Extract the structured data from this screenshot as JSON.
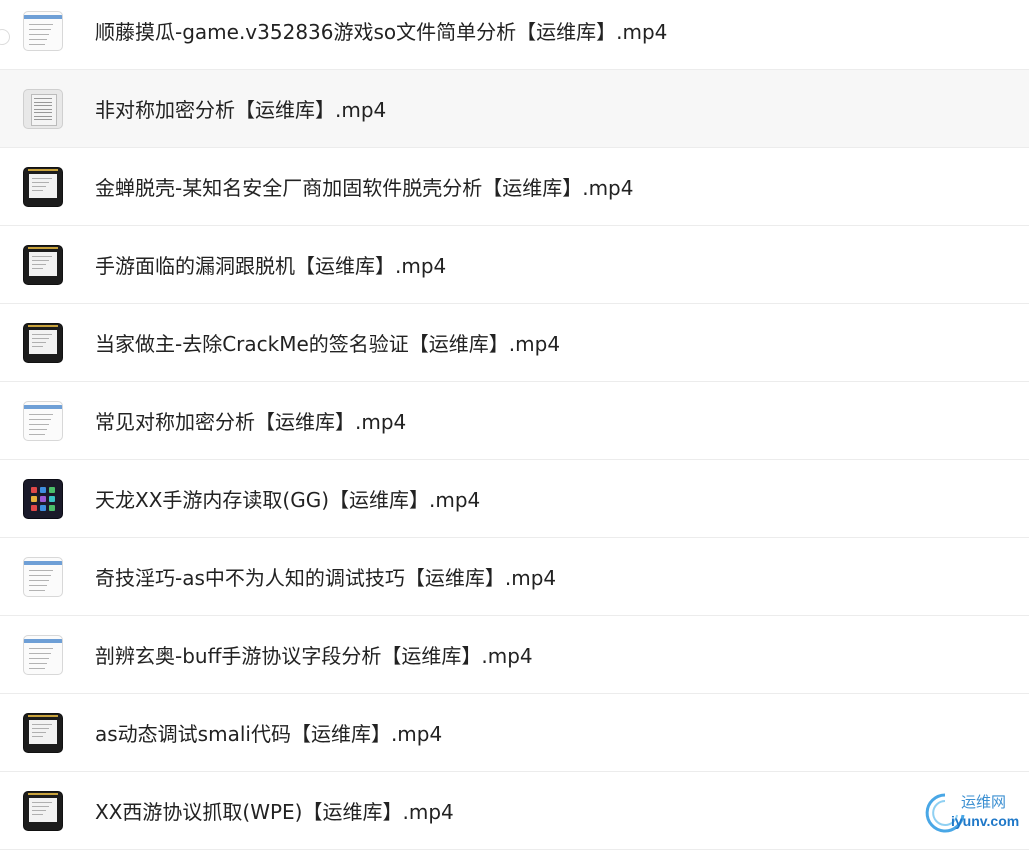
{
  "files": [
    {
      "name": "顺藤摸瓜-game.v352836游戏so文件简单分析【运维库】.mp4",
      "thumb": "light",
      "thumb_icon": "screenshot-thumbnail-icon"
    },
    {
      "name": "非对称加密分析【运维库】.mp4",
      "thumb": "doc",
      "thumb_icon": "document-thumbnail-icon"
    },
    {
      "name": "金蝉脱壳-某知名安全厂商加固软件脱壳分析【运维库】.mp4",
      "thumb": "dark",
      "thumb_icon": "video-thumbnail-icon"
    },
    {
      "name": "手游面临的漏洞跟脱机【运维库】.mp4",
      "thumb": "dark",
      "thumb_icon": "video-thumbnail-icon"
    },
    {
      "name": "当家做主-去除CrackMe的签名验证【运维库】.mp4",
      "thumb": "dark",
      "thumb_icon": "video-thumbnail-icon"
    },
    {
      "name": "常见对称加密分析【运维库】.mp4",
      "thumb": "light",
      "thumb_icon": "screenshot-thumbnail-icon"
    },
    {
      "name": "天龙XX手游内存读取(GG)【运维库】.mp4",
      "thumb": "tablet",
      "thumb_icon": "tablet-thumbnail-icon"
    },
    {
      "name": "奇技淫巧-as中不为人知的调试技巧【运维库】.mp4",
      "thumb": "light",
      "thumb_icon": "screenshot-thumbnail-icon"
    },
    {
      "name": "剖辨玄奥-buff手游协议字段分析【运维库】.mp4",
      "thumb": "light",
      "thumb_icon": "screenshot-thumbnail-icon"
    },
    {
      "name": "as动态调试smali代码【运维库】.mp4",
      "thumb": "dark",
      "thumb_icon": "video-thumbnail-icon"
    },
    {
      "name": "XX西游协议抓取(WPE)【运维库】.mp4",
      "thumb": "dark",
      "thumb_icon": "video-thumbnail-icon"
    }
  ],
  "hovered_index": 1,
  "watermark": {
    "cn": "运维网",
    "url": "iyunv.com"
  },
  "colors": {
    "text": "#222222",
    "hover_bg": "#f7f7f7",
    "divider": "#ececec",
    "watermark_blue": "#1f78c8"
  }
}
